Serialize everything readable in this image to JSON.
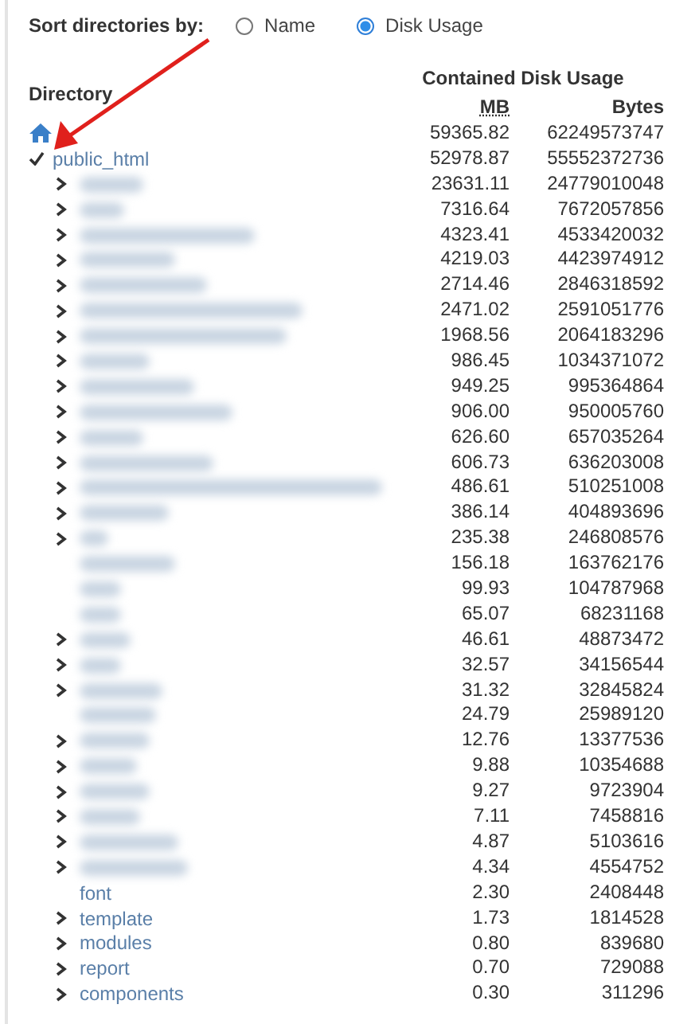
{
  "sort": {
    "label": "Sort directories by:",
    "options": [
      {
        "label": "Name",
        "selected": false
      },
      {
        "label": "Disk Usage",
        "selected": true
      }
    ]
  },
  "table": {
    "directory_heading": "Directory",
    "usage_heading": "Contained Disk Usage",
    "columns": [
      "MB",
      "Bytes"
    ]
  },
  "annotation": {
    "kind": "arrow"
  },
  "root": {
    "kind": "home",
    "mb": "59365.82",
    "bytes": "62249573747",
    "children": [
      {
        "name": "public_html",
        "redacted": false,
        "has_children": true,
        "expanded": true,
        "mb": "52978.87",
        "bytes": "55552372736",
        "children": [
          {
            "redacted": true,
            "has_children": true,
            "expanded": false,
            "mb": "23631.11",
            "bytes": "24779010048"
          },
          {
            "redacted": true,
            "has_children": true,
            "expanded": false,
            "mb": "7316.64",
            "bytes": "7672057856"
          },
          {
            "redacted": true,
            "has_children": true,
            "expanded": false,
            "mb": "4323.41",
            "bytes": "4533420032"
          },
          {
            "redacted": true,
            "has_children": true,
            "expanded": false,
            "mb": "4219.03",
            "bytes": "4423974912"
          },
          {
            "redacted": true,
            "has_children": true,
            "expanded": false,
            "mb": "2714.46",
            "bytes": "2846318592"
          },
          {
            "redacted": true,
            "has_children": true,
            "expanded": false,
            "mb": "2471.02",
            "bytes": "2591051776"
          },
          {
            "redacted": true,
            "has_children": true,
            "expanded": false,
            "mb": "1968.56",
            "bytes": "2064183296"
          },
          {
            "redacted": true,
            "has_children": true,
            "expanded": false,
            "mb": "986.45",
            "bytes": "1034371072"
          },
          {
            "redacted": true,
            "has_children": true,
            "expanded": false,
            "mb": "949.25",
            "bytes": "995364864"
          },
          {
            "redacted": true,
            "has_children": true,
            "expanded": false,
            "mb": "906.00",
            "bytes": "950005760"
          },
          {
            "redacted": true,
            "has_children": true,
            "expanded": false,
            "mb": "626.60",
            "bytes": "657035264"
          },
          {
            "redacted": true,
            "has_children": true,
            "expanded": false,
            "mb": "606.73",
            "bytes": "636203008"
          },
          {
            "redacted": true,
            "has_children": true,
            "expanded": false,
            "mb": "486.61",
            "bytes": "510251008"
          },
          {
            "redacted": true,
            "has_children": true,
            "expanded": false,
            "mb": "386.14",
            "bytes": "404893696"
          },
          {
            "redacted": true,
            "has_children": true,
            "expanded": false,
            "mb": "235.38",
            "bytes": "246808576"
          },
          {
            "redacted": true,
            "has_children": false,
            "mb": "156.18",
            "bytes": "163762176"
          },
          {
            "redacted": true,
            "has_children": false,
            "mb": "99.93",
            "bytes": "104787968"
          },
          {
            "redacted": true,
            "has_children": false,
            "mb": "65.07",
            "bytes": "68231168"
          },
          {
            "redacted": true,
            "has_children": true,
            "expanded": false,
            "mb": "46.61",
            "bytes": "48873472"
          },
          {
            "redacted": true,
            "has_children": true,
            "expanded": false,
            "mb": "32.57",
            "bytes": "34156544"
          },
          {
            "redacted": true,
            "has_children": true,
            "expanded": false,
            "mb": "31.32",
            "bytes": "32845824"
          },
          {
            "redacted": true,
            "has_children": false,
            "mb": "24.79",
            "bytes": "25989120"
          },
          {
            "redacted": true,
            "has_children": true,
            "expanded": false,
            "mb": "12.76",
            "bytes": "13377536"
          },
          {
            "redacted": true,
            "has_children": true,
            "expanded": false,
            "mb": "9.88",
            "bytes": "10354688"
          },
          {
            "redacted": true,
            "has_children": true,
            "expanded": false,
            "mb": "9.27",
            "bytes": "9723904"
          },
          {
            "redacted": true,
            "has_children": true,
            "expanded": false,
            "mb": "7.11",
            "bytes": "7458816"
          },
          {
            "redacted": true,
            "has_children": true,
            "expanded": false,
            "mb": "4.87",
            "bytes": "5103616"
          },
          {
            "redacted": true,
            "has_children": true,
            "expanded": false,
            "mb": "4.34",
            "bytes": "4554752"
          },
          {
            "name": "font",
            "redacted": false,
            "has_children": false,
            "mb": "2.30",
            "bytes": "2408448"
          },
          {
            "name": "template",
            "redacted": false,
            "has_children": true,
            "expanded": false,
            "mb": "1.73",
            "bytes": "1814528"
          },
          {
            "name": "modules",
            "redacted": false,
            "has_children": true,
            "expanded": false,
            "mb": "0.80",
            "bytes": "839680"
          },
          {
            "name": "report",
            "redacted": false,
            "has_children": true,
            "expanded": false,
            "mb": "0.70",
            "bytes": "729088"
          },
          {
            "name": "components",
            "redacted": false,
            "has_children": true,
            "expanded": false,
            "mb": "0.30",
            "bytes": "311296"
          }
        ]
      }
    ]
  }
}
